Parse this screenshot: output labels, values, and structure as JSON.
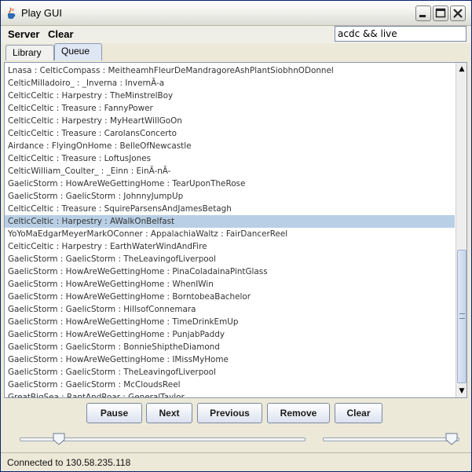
{
  "window": {
    "title": "Play GUI"
  },
  "menu": {
    "server": "Server",
    "clear": "Clear"
  },
  "search": {
    "value": "acdc && live"
  },
  "tabs": [
    {
      "label": "Library",
      "selected": false
    },
    {
      "label": "Queue",
      "selected": true
    }
  ],
  "queue": {
    "items": [
      "Lnasa : CelticCompass : MeitheamhFleurDeMandragoreAshPlantSiobhnODonnel",
      "CelticMilladoiro_ : _Inverna : InvernÃ-a",
      "CelticCeltic : Harpestry : TheMinstrelBoy",
      "CelticCeltic : Treasure : FannyPower",
      "CelticCeltic : Harpestry : MyHeartWillGoOn",
      "CelticCeltic : Treasure : CarolansConcerto",
      "Airdance : FlyingOnHome : BelleOfNewcastle",
      "CelticCeltic : Treasure : LoftusJones",
      "CelticWilliam_Coulter_ : _Einn : EinÃ-nÃ-",
      "GaelicStorm : HowAreWeGettingHome : TearUponTheRose",
      "GaelicStorm : GaelicStorm : JohnnyJumpUp",
      "CelticCeltic : Treasure : SquireParsensAndJamesBetagh",
      "CelticCeltic : Harpestry : AWalkOnBelfast",
      "YoYoMaEdgarMeyerMarkOConner : AppalachiaWaltz : FairDancerReel",
      "CelticCeltic : Harpestry : EarthWaterWindAndFire",
      "GaelicStorm : GaelicStorm : TheLeavingofLiverpool",
      "GaelicStorm : HowAreWeGettingHome : PinaColadainaPintGlass",
      "GaelicStorm : HowAreWeGettingHome : WhenIWin",
      "GaelicStorm : HowAreWeGettingHome : BorntobeaBachelor",
      "GaelicStorm : GaelicStorm : HillsofConnemara",
      "GaelicStorm : HowAreWeGettingHome : TimeDrinkEmUp",
      "GaelicStorm : HowAreWeGettingHome : PunjabPaddy",
      "GaelicStorm : GaelicStorm : BonnieShiptheDiamond",
      "GaelicStorm : HowAreWeGettingHome : IMissMyHome",
      "GaelicStorm : GaelicStorm : TheLeavingofLiverpool",
      "GaelicStorm : GaelicStorm : McCloudsReel",
      "GreatBigSea : RantAndRoar : GeneralTaylor"
    ],
    "selected_index": 12
  },
  "buttons": {
    "pause": "Pause",
    "next": "Next",
    "previous": "Previous",
    "remove": "Remove",
    "clear": "Clear"
  },
  "status": {
    "text": "Connected to 130.58.235.118"
  },
  "colors": {
    "selection": "#b8cfe5",
    "accent": "#0a246a",
    "close_button": "#d6442e"
  }
}
